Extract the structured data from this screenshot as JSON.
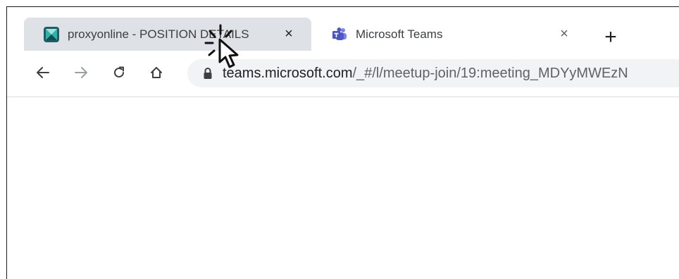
{
  "tabs": [
    {
      "title": "proxyonline - POSITION DETAILS",
      "close_label": "×",
      "favicon": "proxyonline-logo-icon",
      "active": false
    },
    {
      "title": "Microsoft Teams",
      "close_label": "×",
      "favicon": "microsoft-teams-icon",
      "active": true
    }
  ],
  "new_tab_label": "+",
  "toolbar": {
    "back_icon": "arrow-left-icon",
    "forward_icon": "arrow-right-icon",
    "reload_icon": "reload-icon",
    "home_icon": "home-icon",
    "secure_icon": "lock-icon",
    "url_domain": "teams.microsoft.com",
    "url_path": "/_#/l/meetup-join/19:meeting_MDYyMWEzN"
  },
  "cursor": "click-pointer-icon",
  "colors": {
    "tab_inactive_bg": "#dee1e6",
    "omnibox_bg": "#f1f3f4",
    "proxyonline_brand": "#1b6d73",
    "teams_brand": "#5059c9"
  }
}
